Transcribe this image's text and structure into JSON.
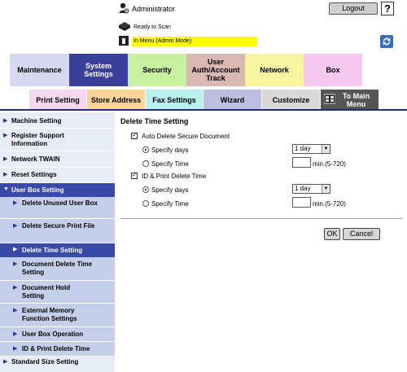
{
  "header": {
    "user": "Administrator",
    "logout_label": "Logout",
    "help_label": "?",
    "status": "Ready to Scan",
    "mode": "In Menu (Admin Mode)"
  },
  "main_tabs": [
    {
      "label": "Maintenance",
      "color": "#d5d8ef"
    },
    {
      "label": "System Settings",
      "color": "#3a3f9a",
      "active": true
    },
    {
      "label": "Security",
      "color": "#c8f0a0"
    },
    {
      "label": "User Auth/Account Track",
      "color": "#d9b8b3"
    },
    {
      "label": "Network",
      "color": "#f8f5a0"
    },
    {
      "label": "Box",
      "color": "#f5c8f0"
    }
  ],
  "sub_tabs": [
    {
      "label": "Print Setting",
      "color": "#f5d8f0"
    },
    {
      "label": "Store Address",
      "color": "#f8d39a"
    },
    {
      "label": "Fax Settings",
      "color": "#b8f0ef"
    },
    {
      "label": "Wizard",
      "color": "#bdbde0"
    },
    {
      "label": "Customize",
      "color": "#d9d9d9"
    },
    {
      "label": "To Main Menu",
      "color": "#555555"
    }
  ],
  "sidebar": {
    "items": [
      {
        "label": "Machine Setting"
      },
      {
        "label": "Register Support Information"
      },
      {
        "label": "Network TWAIN"
      },
      {
        "label": "Reset Settings"
      },
      {
        "label": "User Box Setting"
      },
      {
        "label": "Delete Unused User Box"
      },
      {
        "label": "Delete Secure Print File"
      },
      {
        "label": "Delete Time Setting"
      },
      {
        "label": "Document Delete Time Setting"
      },
      {
        "label": "Document Hold Setting"
      },
      {
        "label": "External Memory Function Settings"
      },
      {
        "label": "User Box Operation"
      },
      {
        "label": "ID & Print Delete Time"
      },
      {
        "label": "Standard Size Setting"
      }
    ]
  },
  "content": {
    "title": "Delete Time Setting",
    "section1": {
      "label": "Auto Delete Secure Document",
      "checked": true,
      "opt_days": "Specify days",
      "opt_time": "Specify Time",
      "days_value": "1 day",
      "time_value": "",
      "range": "min.(5-720)"
    },
    "section2": {
      "label": "ID & Print Delete Time",
      "checked": true,
      "opt_days": "Specify days",
      "opt_time": "Specify Time",
      "days_value": "1 day",
      "time_value": "",
      "range": "min.(5-720)"
    },
    "ok_label": "OK",
    "cancel_label": "Cancel"
  },
  "icons": {
    "user": "user-icon",
    "scanner": "scanner-icon",
    "mode": "mode-icon",
    "refresh": "refresh-icon",
    "main-menu": "main-menu-icon"
  }
}
